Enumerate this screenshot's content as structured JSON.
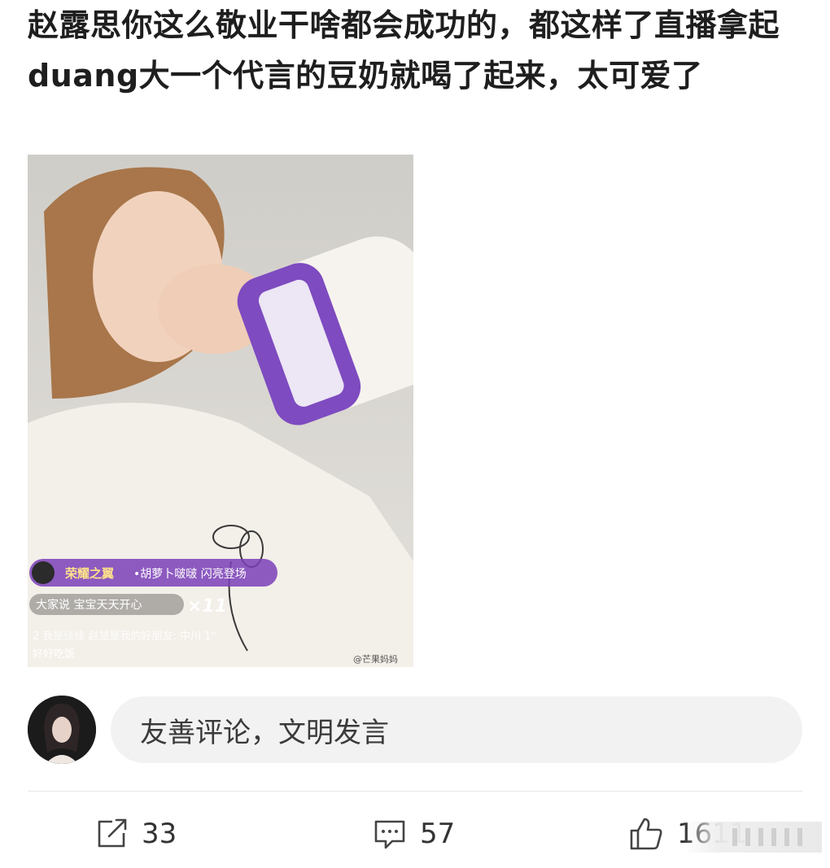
{
  "post": {
    "text": "赵露思你这么敬业干啥都会成功的，都这样了直播拿起duang大一个代言的豆奶就喝了起来，太可爱了"
  },
  "image": {
    "badge_title": "荣耀之翼",
    "badge_event": "•胡萝卜啵啵 闪亮登场",
    "chat_line1": "大家说 宝宝天天开心",
    "chat_multiplier": "×11",
    "chat_line2": "2  我是佳佳 赵慧是我的好朋友: 中川 1\"",
    "chat_line3": "好好吃饭",
    "watermark": "@芒果妈妈"
  },
  "comment": {
    "placeholder": "友善评论，文明发言"
  },
  "actions": {
    "repost_count": "33",
    "comment_count": "57",
    "like_count": "1611"
  },
  "colors": {
    "text": "#1e1e1e",
    "comment_bg": "#f2f2f2",
    "badge_purple": "#7a3fb8"
  }
}
